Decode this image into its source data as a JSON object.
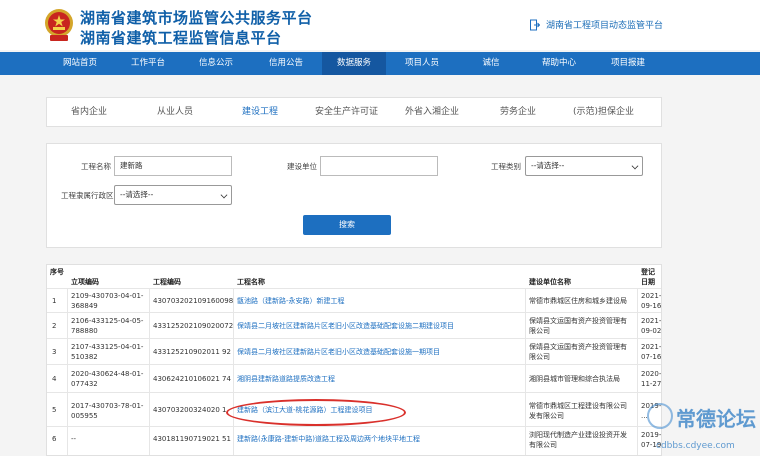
{
  "header": {
    "title_line1": "湖南省建筑市场监管公共服务平台",
    "title_line2": "湖南省建筑工程监管信息平台",
    "monitor_link": "湖南省工程项目动态监管平台"
  },
  "nav": {
    "items": [
      "网站首页",
      "工作平台",
      "信息公示",
      "信用公告",
      "数据服务",
      "项目人员",
      "诚信",
      "帮助中心",
      "项目报建"
    ],
    "active_index": 4
  },
  "tabs": {
    "items": [
      "省内企业",
      "从业人员",
      "建设工程",
      "安全生产许可证",
      "外省入湘企业",
      "劳务企业",
      "(示范)担保企业"
    ],
    "active_index": 2
  },
  "search_form": {
    "project_name_label": "工程名称",
    "project_name_value": "建新路",
    "builder_label": "建设单位",
    "builder_value": "",
    "category_label": "工程类别",
    "category_value": "--请选择--",
    "region_label": "工程隶属行政区",
    "region_value": "--请选择--",
    "search_button": "搜索"
  },
  "table": {
    "headers": [
      "序号",
      "立项编码",
      "工程编码",
      "工程名称",
      "建设单位名称",
      "登记日期"
    ],
    "rows": [
      {
        "no": "1",
        "approval_code": [
          "2109-430703-04-01-",
          "368849"
        ],
        "project_code": "430703202109160098",
        "name": "甑池路（建新路-永安路）新建工程",
        "builder": [
          "常德市鼎城区住房和城乡建设局"
        ],
        "date": [
          "2021-",
          "09-16"
        ]
      },
      {
        "no": "2",
        "approval_code": [
          "2106-433125-04-05-",
          "788880"
        ],
        "project_code": "433125202109020072",
        "name": "保靖县二月坡社区建新路片区老旧小区改造基础配套设施二期建设项目",
        "builder": [
          "保靖县文运国有资产投资管理有",
          "限公司"
        ],
        "date": [
          "2021-",
          "09-02"
        ]
      },
      {
        "no": "3",
        "approval_code": [
          "2107-433125-04-01-",
          "510382"
        ],
        "project_code": "433125210902011 92",
        "name": "保靖县二月坡社区建新路片区老旧小区改造基础配套设施一期项目",
        "builder": [
          "保靖县文运国有资产投资管理有",
          "限公司"
        ],
        "date": [
          "2021-",
          "07-16"
        ]
      },
      {
        "no": "4",
        "approval_code": [
          "2020-430624-48-01-",
          "077432"
        ],
        "project_code": "430624210106021 74",
        "name": "湘阴县建新路道路提质改造工程",
        "builder": [
          "湘阴县城市管理和综合执法局"
        ],
        "date": [
          "2020-",
          "11-27"
        ]
      },
      {
        "no": "5",
        "approval_code": [
          "2017-430703-78-01-",
          "005955"
        ],
        "project_code": "430703200324020 1",
        "name": "建新路（滨江大道-桃花源路）工程建设项目",
        "builder": [
          "常德市鼎城区工程建设有限公司",
          "发有限公司"
        ],
        "date": [
          "2019-",
          "..."
        ]
      },
      {
        "no": "6",
        "approval_code": [
          "--"
        ],
        "project_code": "430181190719021 51",
        "name": "建新路(永康路-建新中路)道路工程及周边两个地块平地工程",
        "builder": [
          "浏阳现代制造产业建设投资开发",
          "有限公司"
        ],
        "date": [
          "2019-",
          "07-19"
        ]
      }
    ]
  },
  "watermark": {
    "text": "常德论坛",
    "url": "cdbbs.cdyee.com"
  }
}
